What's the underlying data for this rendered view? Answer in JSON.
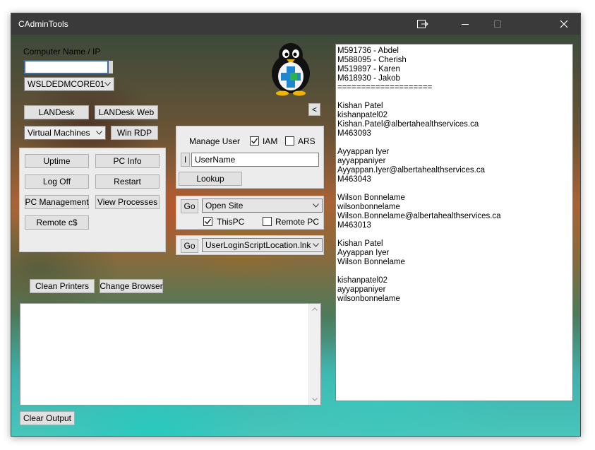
{
  "window": {
    "title": "CAdminTools"
  },
  "computer": {
    "label": "Computer Name / IP",
    "input_value": "",
    "selected_computer": "WSLDEDMCORE01"
  },
  "buttons": {
    "landesk": "LANDesk",
    "landesk_web": "LANDesk Web",
    "win_rdp": "Win RDP",
    "uptime": "Uptime",
    "pc_info": "PC Info",
    "log_off": "Log Off",
    "restart": "Restart",
    "pc_management": "PC Management",
    "view_processes": "View Processes",
    "remote_c": "Remote c$",
    "clean_printers": "Clean Printers",
    "change_browser": "Change Browser",
    "clear_output": "Clear Output",
    "collapse": "<",
    "lookup": "Lookup",
    "go": "Go",
    "go2": "Go",
    "i": "I"
  },
  "virtual_machines": {
    "selected": "Virtual Machines"
  },
  "manage_user": {
    "label": "Manage User",
    "iam_label": "IAM",
    "iam_checked": true,
    "ars_label": "ARS",
    "ars_checked": false,
    "username_value": "UserName"
  },
  "open_site": {
    "selected": "Open Site",
    "this_pc_label": "ThisPC",
    "this_pc_checked": true,
    "remote_pc_label": "Remote PC",
    "remote_pc_checked": false
  },
  "script": {
    "selected": "UserLoginScriptLocation.lnk"
  },
  "output_lines": [
    "M591736 - Abdel",
    "M588095 - Cherish",
    "M519897 - Karen",
    "M618930 - Jakob",
    "====================",
    "",
    "Kishan Patel",
    "kishanpatel02",
    "Kishan.Patel@albertahealthservices.ca",
    "M463093",
    "",
    "Ayyappan Iyer",
    "ayyappaniyer",
    "Ayyappan.Iyer@albertahealthservices.ca",
    "M463043",
    "",
    "Wilson Bonnelame",
    "wilsonbonnelame",
    "Wilson.Bonnelame@albertahealthservices.ca",
    "M463013",
    "",
    "Kishan Patel",
    "Ayyappan Iyer",
    "Wilson Bonnelame",
    "",
    "kishanpatel02",
    "ayyappaniyer",
    "wilsonbonnelame"
  ],
  "colors": {
    "titlebar": "#3a3a3a",
    "button_face": "#e1e1e1",
    "panel": "#ececec"
  }
}
